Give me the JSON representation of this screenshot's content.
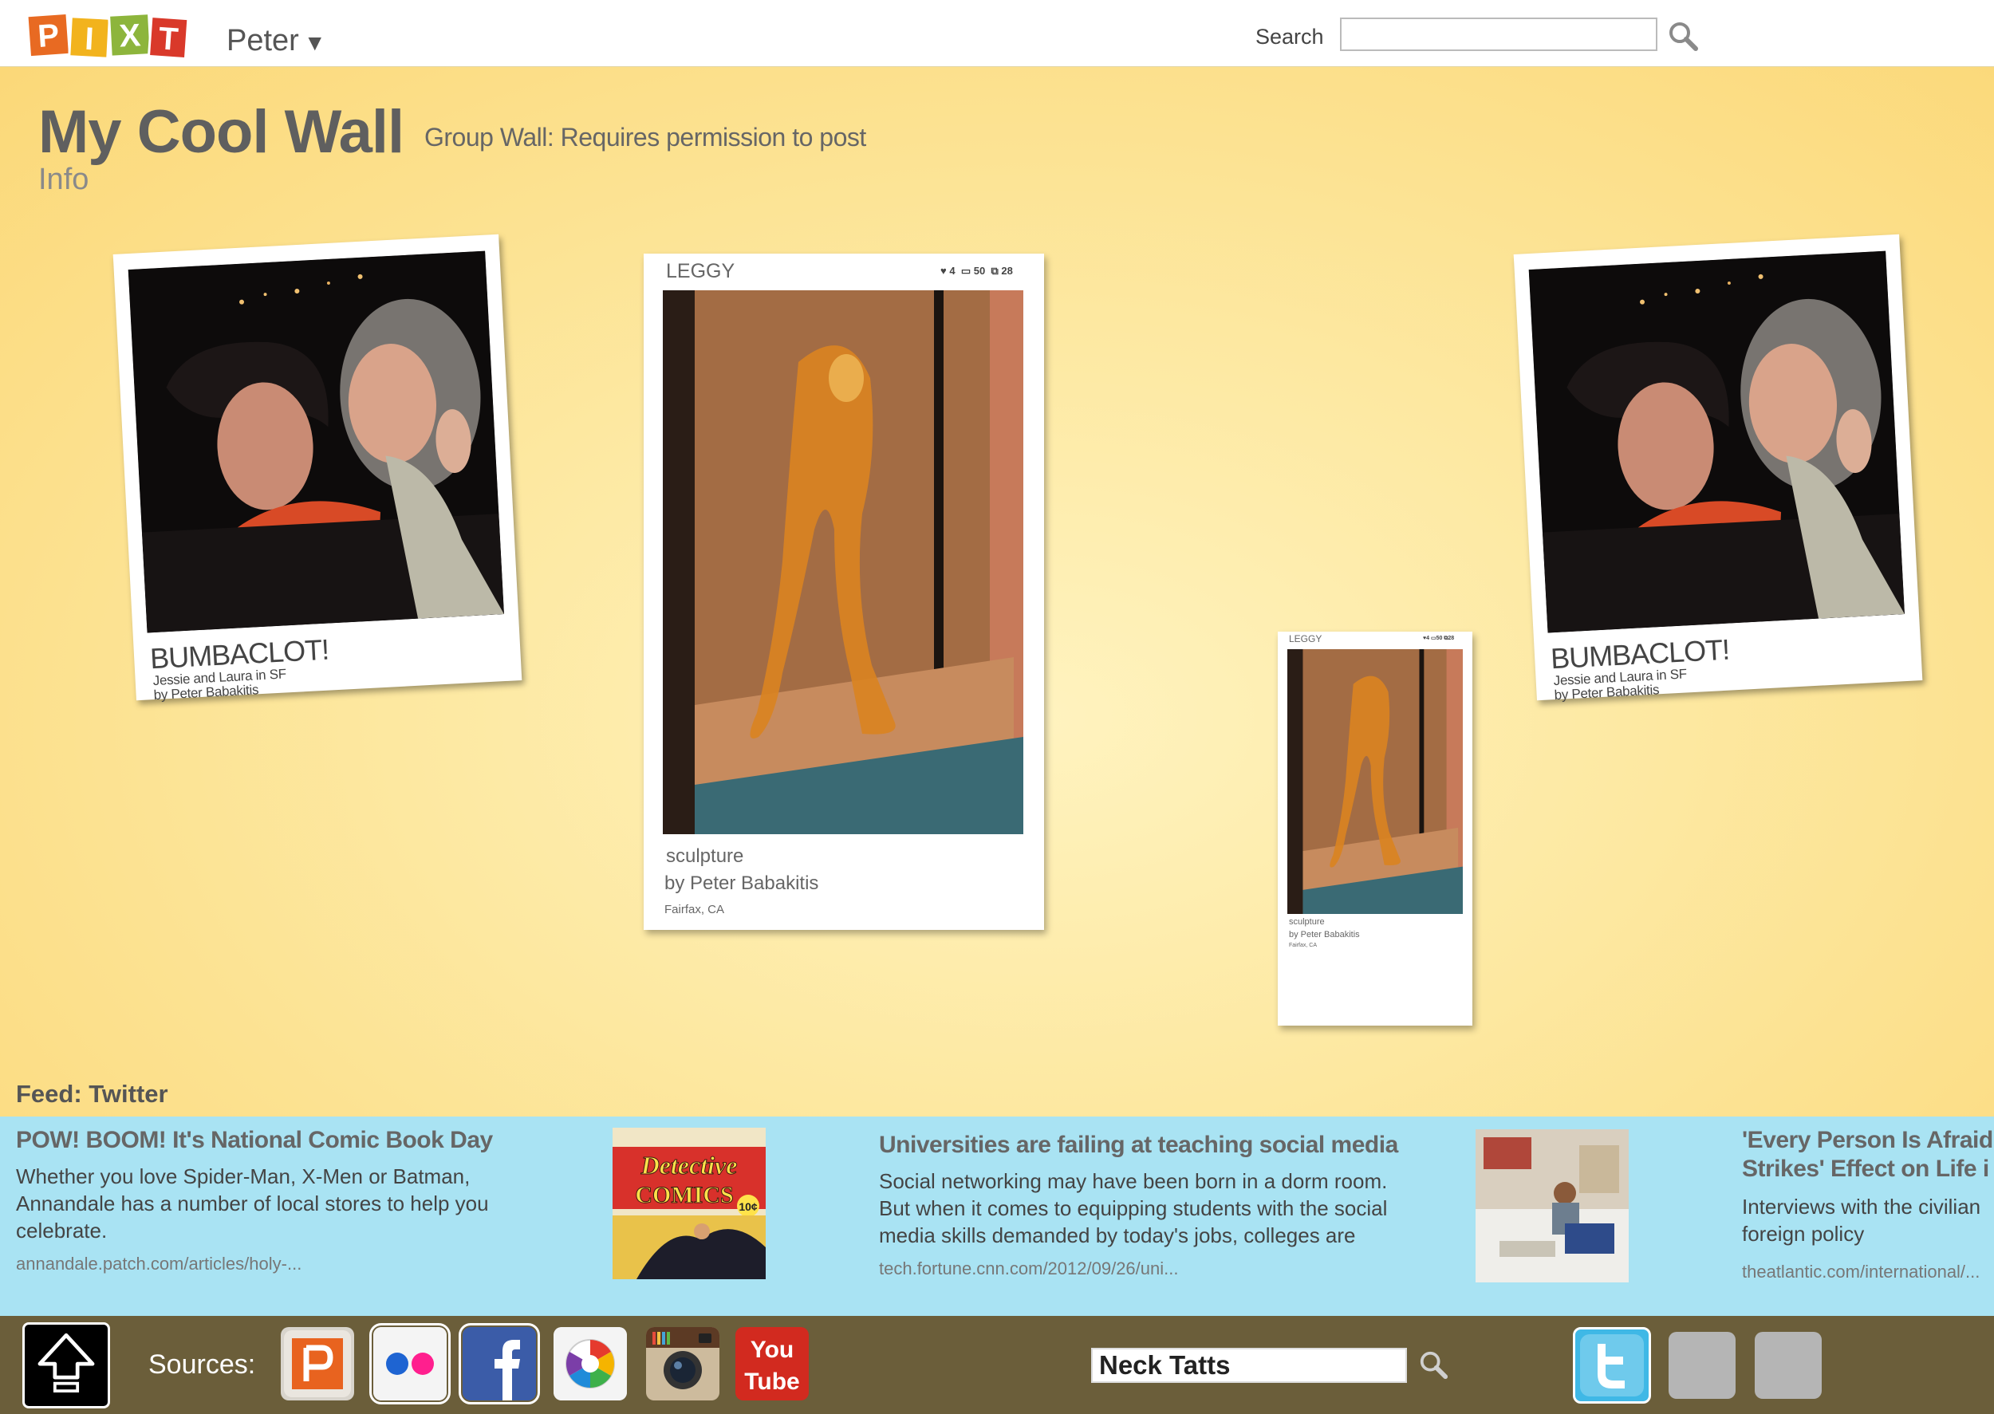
{
  "header": {
    "logo_letters": [
      "P",
      "I",
      "X",
      "T"
    ],
    "user_name": "Peter",
    "search_label": "Search",
    "search_value": ""
  },
  "wall": {
    "title": "My Cool Wall",
    "subtitle": "Group Wall: Requires permission to post",
    "info_link": "Info",
    "cards": [
      {
        "title": "BUMBACLOT!",
        "caption": "Jessie and Laura in SF",
        "byline": "by Peter Babakitis"
      },
      {
        "title": "LEGGY",
        "stats": [
          "4",
          "50",
          "28"
        ],
        "caption": "sculpture",
        "byline": "by Peter Babakitis",
        "location": "Fairfax, CA"
      },
      {
        "title": "LEGGY",
        "stats": [
          "4",
          "50",
          "28"
        ],
        "caption": "sculpture",
        "byline": "by Peter Babakitis",
        "location": "Fairfax, CA"
      },
      {
        "title": "BUMBACLOT!",
        "caption": "Jessie and Laura in SF",
        "byline": "by Peter Babakitis"
      }
    ],
    "feed_label": "Feed: Twitter"
  },
  "feed": {
    "items": [
      {
        "headline": "POW! BOOM! It's National Comic Book Day",
        "body": "Whether you love Spider-Man, X-Men or Batman, Annandale has a number of local stores to help you celebrate.",
        "url": "annandale.patch.com/articles/holy-..."
      },
      {
        "thumb_lines": [
          "Detective",
          "COMICS"
        ],
        "thumb_price": "10¢"
      },
      {
        "headline": "Universities are failing at teaching social media",
        "body": "Social networking may have been born in a dorm room. But when it comes to equipping students with the social media skills demanded by today's jobs, colleges are",
        "url": "tech.fortune.cnn.com/2012/09/26/uni..."
      },
      {
        "headline_lines": [
          "'Every Person Is Afraid",
          "Strikes' Effect on Life i"
        ],
        "body": "Interviews with the civilian foreign policy",
        "url": "theatlantic.com/international/..."
      }
    ]
  },
  "toolbar": {
    "sources_label": "Sources:",
    "youtube_top": "You",
    "youtube_bottom": "Tube",
    "tag_value": "Neck Tatts"
  },
  "colors": {
    "wall_bg": "#fbd878",
    "feed_bg": "#a9e3f3",
    "toolbar_bg": "#6b5e3a",
    "twitter": "#3fb8e6"
  }
}
